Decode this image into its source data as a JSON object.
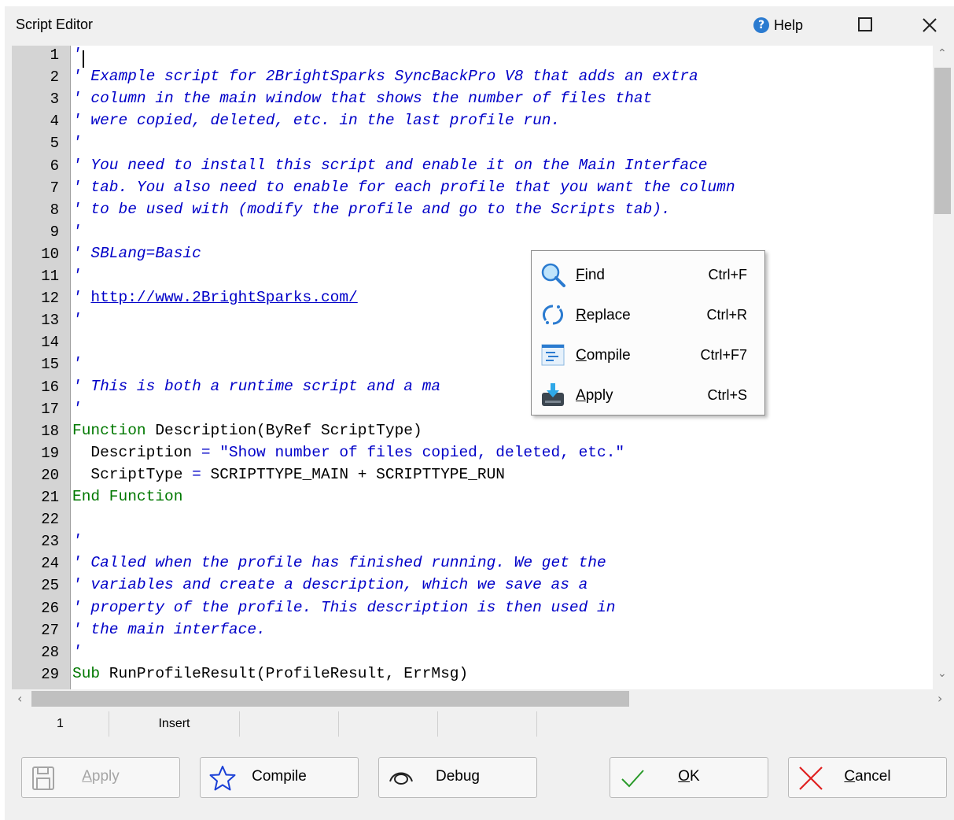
{
  "window": {
    "title": "Script Editor",
    "help_label": "Help"
  },
  "editor": {
    "lines": [
      {
        "n": "1",
        "segs": [
          {
            "t": "'",
            "c": "cm"
          }
        ]
      },
      {
        "n": "2",
        "segs": [
          {
            "t": "' Example script for 2BrightSparks SyncBackPro V8 that adds an extra",
            "c": "cm"
          }
        ]
      },
      {
        "n": "3",
        "segs": [
          {
            "t": "' column in the main window that shows the number of files that",
            "c": "cm"
          }
        ]
      },
      {
        "n": "4",
        "segs": [
          {
            "t": "' were copied, deleted, etc. in the last profile run.",
            "c": "cm"
          }
        ]
      },
      {
        "n": "5",
        "segs": [
          {
            "t": "'",
            "c": "cm"
          }
        ]
      },
      {
        "n": "6",
        "segs": [
          {
            "t": "' You need to install this script and enable it on the Main Interface",
            "c": "cm"
          }
        ]
      },
      {
        "n": "7",
        "segs": [
          {
            "t": "' tab. You also need to enable for each profile that you want the column",
            "c": "cm"
          }
        ]
      },
      {
        "n": "8",
        "segs": [
          {
            "t": "' to be used with (modify the profile and go to the Scripts tab).",
            "c": "cm"
          }
        ]
      },
      {
        "n": "9",
        "segs": [
          {
            "t": "'",
            "c": "cm"
          }
        ]
      },
      {
        "n": "10",
        "segs": [
          {
            "t": "' SBLang=Basic",
            "c": "cm"
          }
        ]
      },
      {
        "n": "11",
        "segs": [
          {
            "t": "'",
            "c": "cm"
          }
        ]
      },
      {
        "n": "12",
        "segs": [
          {
            "t": "' ",
            "c": "cm"
          },
          {
            "t": "http://www.2BrightSparks.com/",
            "c": "url"
          }
        ]
      },
      {
        "n": "13",
        "segs": [
          {
            "t": "'",
            "c": "cm"
          }
        ]
      },
      {
        "n": "14",
        "segs": []
      },
      {
        "n": "15",
        "segs": [
          {
            "t": "'",
            "c": "cm"
          }
        ]
      },
      {
        "n": "16",
        "segs": [
          {
            "t": "' This is both a runtime script and a ma",
            "c": "cm"
          }
        ]
      },
      {
        "n": "17",
        "segs": [
          {
            "t": "'",
            "c": "cm"
          }
        ]
      },
      {
        "n": "18",
        "segs": [
          {
            "t": "Function",
            "c": "kw"
          },
          {
            "t": " Description(ByRef ScriptType)",
            "c": "pl"
          }
        ]
      },
      {
        "n": "19",
        "segs": [
          {
            "t": "  Description ",
            "c": "pl"
          },
          {
            "t": "=",
            "c": "str"
          },
          {
            "t": " ",
            "c": "pl"
          },
          {
            "t": "\"Show number of files copied, deleted, etc.\"",
            "c": "str"
          }
        ]
      },
      {
        "n": "20",
        "segs": [
          {
            "t": "  ScriptType ",
            "c": "pl"
          },
          {
            "t": "=",
            "c": "str"
          },
          {
            "t": " SCRIPTTYPE_MAIN + SCRIPTTYPE_RUN",
            "c": "pl"
          }
        ]
      },
      {
        "n": "21",
        "segs": [
          {
            "t": "End Function",
            "c": "kw"
          }
        ]
      },
      {
        "n": "22",
        "segs": []
      },
      {
        "n": "23",
        "segs": [
          {
            "t": "'",
            "c": "cm"
          }
        ]
      },
      {
        "n": "24",
        "segs": [
          {
            "t": "' Called when the profile has finished running. We get the",
            "c": "cm"
          }
        ]
      },
      {
        "n": "25",
        "segs": [
          {
            "t": "' variables and create a description, which we save as a",
            "c": "cm"
          }
        ]
      },
      {
        "n": "26",
        "segs": [
          {
            "t": "' property of the profile. This description is then used in",
            "c": "cm"
          }
        ]
      },
      {
        "n": "27",
        "segs": [
          {
            "t": "' the main interface.",
            "c": "cm"
          }
        ]
      },
      {
        "n": "28",
        "segs": [
          {
            "t": "'",
            "c": "cm"
          }
        ]
      },
      {
        "n": "29",
        "segs": [
          {
            "t": "Sub",
            "c": "kw"
          },
          {
            "t": " RunProfileResult(ProfileResult, ",
            "c": "pl"
          },
          {
            "t": "ErrMsg)",
            "c": "pl"
          }
        ]
      }
    ]
  },
  "status": {
    "line": "1",
    "mode": "Insert"
  },
  "context_menu": {
    "items": [
      {
        "pre": "",
        "key_letter": "F",
        "post": "ind",
        "shortcut": "Ctrl+F",
        "icon": "search-icon"
      },
      {
        "pre": "",
        "key_letter": "R",
        "post": "eplace",
        "shortcut": "Ctrl+R",
        "icon": "replace-icon"
      },
      {
        "pre": "",
        "key_letter": "C",
        "post": "ompile",
        "shortcut": "Ctrl+F7",
        "icon": "compile-icon"
      },
      {
        "pre": "",
        "key_letter": "A",
        "post": "pply",
        "shortcut": "Ctrl+S",
        "icon": "apply-icon"
      }
    ]
  },
  "buttons": {
    "apply": {
      "key_letter": "A",
      "rest": "pply"
    },
    "compile": "Compile",
    "debug": "Debug",
    "ok": {
      "key_letter": "O",
      "rest": "K"
    },
    "cancel": {
      "key_letter": "C",
      "rest": "ancel"
    }
  },
  "colors": {
    "comment": "#0000c8",
    "keyword": "#007800",
    "gutter": "#d4d4d4",
    "help_accent": "#2b7bd0",
    "cancel_red": "#e02020",
    "ok_green": "#2a9a2a"
  }
}
